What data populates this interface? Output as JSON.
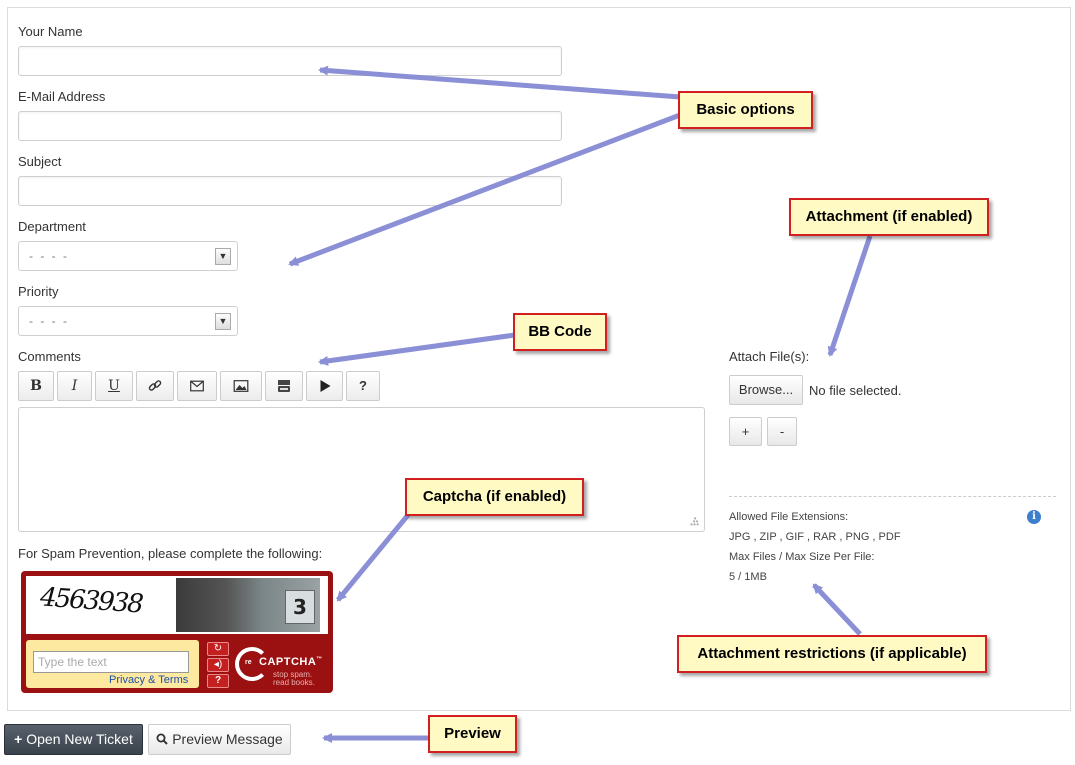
{
  "form": {
    "name_label": "Your Name",
    "email_label": "E-Mail Address",
    "subject_label": "Subject",
    "department_label": "Department",
    "department_value": "- - - -",
    "priority_label": "Priority",
    "priority_value": "- - - -",
    "comments_label": "Comments",
    "spam_label": "For Spam Prevention, please complete the following:"
  },
  "toolbar": {
    "bold": "B",
    "italic": "I",
    "underline": "U",
    "help": "?"
  },
  "captcha": {
    "challenge_text": "4563938",
    "photo_number": "3",
    "input_placeholder": "Type the text",
    "links": "Privacy & Terms",
    "logo_re": "re",
    "logo_name": "CAPTCHA",
    "logo_tm": "™",
    "slogan_line1": "stop spam.",
    "slogan_line2": "read books."
  },
  "attachment": {
    "label": "Attach File(s):",
    "browse_label": "Browse...",
    "no_file": "No file selected.",
    "add_label": "+",
    "remove_label": "-",
    "extensions_label": "Allowed File Extensions:",
    "extensions_value": "JPG , ZIP , GIF , RAR , PNG , PDF",
    "limits_label": "Max Files / Max Size Per File:",
    "limits_value": "5 / 1MB"
  },
  "actions": {
    "open_ticket": "Open New Ticket",
    "preview": "Preview Message"
  },
  "callouts": {
    "basic": "Basic options",
    "attachment": "Attachment (if enabled)",
    "bbcode": "BB Code",
    "captcha": "Captcha (if enabled)",
    "restrictions": "Attachment restrictions (if applicable)",
    "preview": "Preview"
  },
  "colors": {
    "callout_fill": "#fff9c4",
    "callout_border": "#d22020",
    "arrow": "#8a8fd6",
    "captcha_red": "#9b1010",
    "primary_button": "#3b434c"
  },
  "icons": [
    "link-icon",
    "email-icon",
    "image-icon",
    "youtube-icon",
    "play-icon",
    "plus-icon",
    "search-icon",
    "info-icon",
    "refresh-icon",
    "audio-icon",
    "help-icon"
  ]
}
